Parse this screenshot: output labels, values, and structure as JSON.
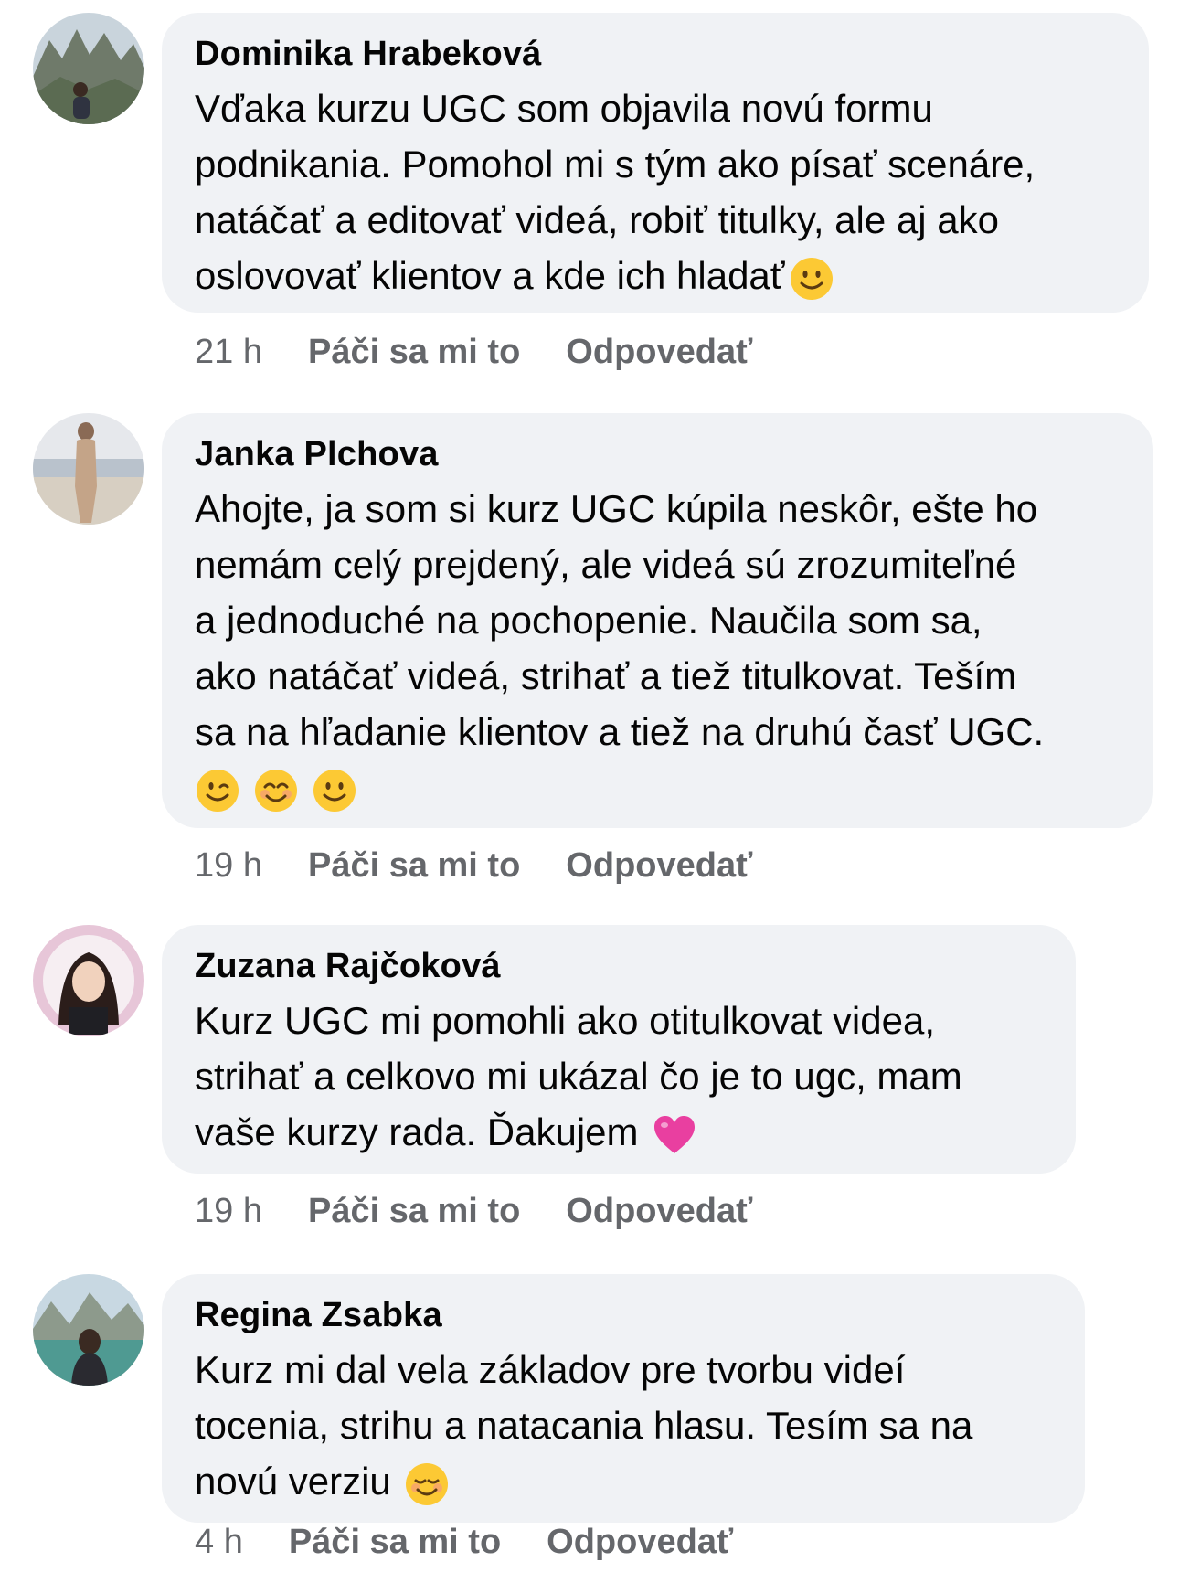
{
  "comments": [
    {
      "author": "Dominika Hrabeková",
      "text": "Vďaka kurzu UGC som objavila novú formu\npodnikania. Pomohol mi s tým ako písať scenáre,\nnatáčať a editovať videá, robiť titulky, ale aj ako\noslovovať klientov a kde ich hladať",
      "emojis": [
        "slightly-smiling-face"
      ],
      "time": "21 h",
      "like_label": "Páči sa mi to",
      "reply_label": "Odpovedať"
    },
    {
      "author": "Janka Plchova",
      "text": "Ahojte, ja som si kurz UGC kúpila neskôr, ešte ho\nnemám celý prejdený, ale videá sú zrozumiteľné\na jednoduché na pochopenie. Naučila som sa,\nako natáčať videá, strihať a tiež titulkovat. Teším\nsa na hľadanie klientov a tiež na druhú časť UGC.",
      "emojis": [
        "winking-face",
        "smiling-face-with-smiling-eyes",
        "slightly-smiling-face"
      ],
      "time": "19 h",
      "like_label": "Páči sa mi to",
      "reply_label": "Odpovedať"
    },
    {
      "author": "Zuzana Rajčoková",
      "text": "Kurz UGC mi pomohli ako otitulkovat videa,\nstrihať a celkovo mi ukázal čo je to ugc, mam\nvaše kurzy rada. Ďakujem",
      "emojis": [
        "pink-heart"
      ],
      "time": "19 h",
      "like_label": "Páči sa mi to",
      "reply_label": "Odpovedať"
    },
    {
      "author": "Regina Zsabka",
      "text": "Kurz mi dal vela základov pre tvorbu videí\ntocenia, strihu a natacania hlasu. Tesím sa na\nnovú verziu",
      "emojis": [
        "smiling-face"
      ],
      "time": "4 h",
      "like_label": "Páči sa mi to",
      "reply_label": "Odpovedať"
    }
  ],
  "colors": {
    "bubble": "#f0f2f5",
    "meta_text": "#65676b",
    "main_text": "#050505",
    "emoji_yellow": "#fcc934",
    "heart_pink": "#e93fa0"
  }
}
